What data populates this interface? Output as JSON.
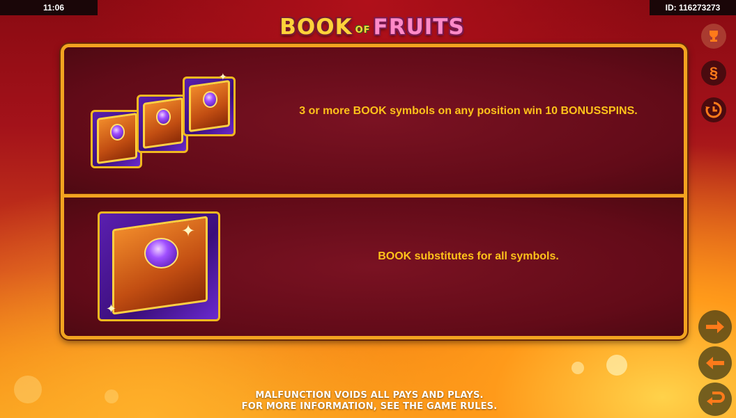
{
  "topbar": {
    "clock": "11:06",
    "session_id": "ID: 116273273"
  },
  "logo": {
    "word1": "BOOK",
    "word_of": "OF",
    "word2": "FRUITS"
  },
  "paytable": {
    "rows": [
      {
        "text": "3 or more BOOK symbols on any position win 10 BONUSSPINS.",
        "icon": "three-book-symbols"
      },
      {
        "text": "BOOK substitutes for all symbols.",
        "icon": "book-symbol"
      }
    ]
  },
  "side_buttons": {
    "rules_symbol": "§",
    "icons": [
      "trophy-icon",
      "section-icon",
      "history-icon",
      "arrow-right-icon",
      "arrow-left-icon",
      "return-icon"
    ]
  },
  "footer": {
    "line1": "MALFUNCTION VOIDS ALL PAYS AND PLAYS.",
    "line2": "FOR MORE INFORMATION, SEE THE GAME RULES."
  },
  "colors": {
    "accent": "#f2a320",
    "text_gold": "#ffc21a",
    "panel": "#6b0d1b",
    "button_orange": "#ff7a1a"
  }
}
